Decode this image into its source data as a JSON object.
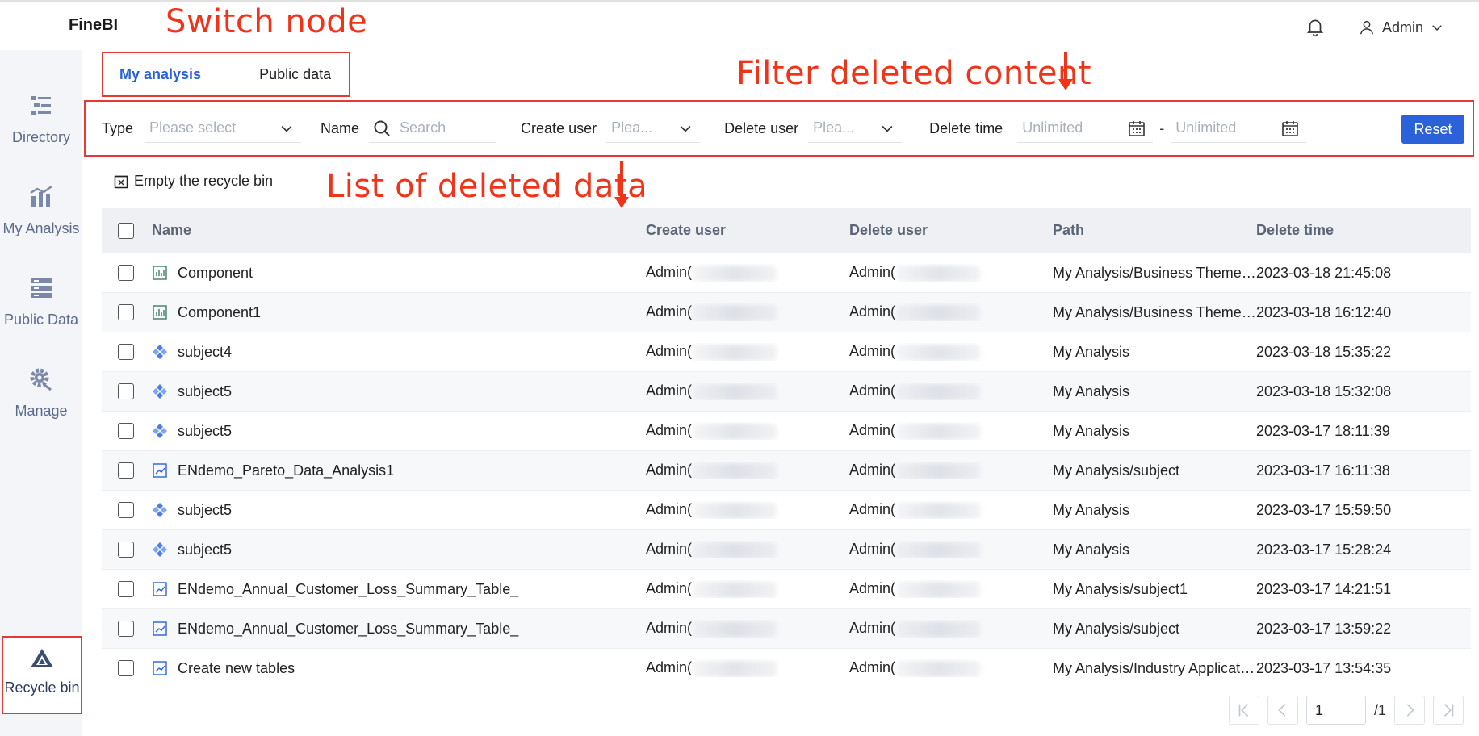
{
  "header": {
    "logo": "FineBI",
    "user": "Admin"
  },
  "sidebar": {
    "items": [
      {
        "label": "Directory",
        "icon": "directory-icon"
      },
      {
        "label": "My Analysis",
        "icon": "chart-icon"
      },
      {
        "label": "Public Data",
        "icon": "database-icon"
      },
      {
        "label": "Manage",
        "icon": "gear-icon"
      },
      {
        "label": "Recycle bin",
        "icon": "recycle-icon",
        "active": true
      }
    ]
  },
  "tabs": [
    "My analysis",
    "Public data"
  ],
  "active_tab": "My analysis",
  "annotations": {
    "switch_node": "Switch node",
    "filter": "Filter deleted content",
    "list": "List of deleted data"
  },
  "filters": {
    "type_label": "Type",
    "type_placeholder": "Please select",
    "name_label": "Name",
    "name_placeholder": "Search",
    "create_user_label": "Create user",
    "create_user_placeholder": "Plea...",
    "delete_user_label": "Delete user",
    "delete_user_placeholder": "Plea...",
    "delete_time_label": "Delete time",
    "start_placeholder": "Unlimited",
    "separator": "-",
    "end_placeholder": "Unlimited",
    "reset": "Reset"
  },
  "empty_bin": "Empty the recycle bin",
  "table": {
    "columns": [
      "Name",
      "Create user",
      "Delete user",
      "Path",
      "Delete time"
    ],
    "rows": [
      {
        "icon": "component",
        "name": "Component",
        "create_user": "Admin(",
        "delete_user": "Admin(",
        "path": "My Analysis/Business Theme…",
        "time": "2023-03-18 21:45:08"
      },
      {
        "icon": "component",
        "name": "Component1",
        "create_user": "Admin(",
        "delete_user": "Admin(",
        "path": "My Analysis/Business Theme…",
        "time": "2023-03-18 16:12:40"
      },
      {
        "icon": "subject",
        "name": "subject4",
        "create_user": "Admin(",
        "delete_user": "Admin(",
        "path": "My Analysis",
        "time": "2023-03-18 15:35:22"
      },
      {
        "icon": "subject",
        "name": "subject5",
        "create_user": "Admin(",
        "delete_user": "Admin(",
        "path": "My Analysis",
        "time": "2023-03-18 15:32:08"
      },
      {
        "icon": "subject",
        "name": "subject5",
        "create_user": "Admin(",
        "delete_user": "Admin(",
        "path": "My Analysis",
        "time": "2023-03-17 18:11:39"
      },
      {
        "icon": "dashboard",
        "name": "ENdemo_Pareto_Data_Analysis1",
        "create_user": "Admin(",
        "delete_user": "Admin(",
        "path": "My Analysis/subject",
        "time": "2023-03-17 16:11:38"
      },
      {
        "icon": "subject",
        "name": "subject5",
        "create_user": "Admin(",
        "delete_user": "Admin(",
        "path": "My Analysis",
        "time": "2023-03-17 15:59:50"
      },
      {
        "icon": "subject",
        "name": "subject5",
        "create_user": "Admin(",
        "delete_user": "Admin(",
        "path": "My Analysis",
        "time": "2023-03-17 15:28:24"
      },
      {
        "icon": "dashboard",
        "name": "ENdemo_Annual_Customer_Loss_Summary_Table_",
        "create_user": "Admin(",
        "delete_user": "Admin(",
        "path": "My Analysis/subject1",
        "time": "2023-03-17 14:21:51"
      },
      {
        "icon": "dashboard",
        "name": "ENdemo_Annual_Customer_Loss_Summary_Table_",
        "create_user": "Admin(",
        "delete_user": "Admin(",
        "path": "My Analysis/subject",
        "time": "2023-03-17 13:59:22"
      },
      {
        "icon": "dashboard",
        "name": "Create new tables",
        "create_user": "Admin(",
        "delete_user": "Admin(",
        "path": "My Analysis/Industry Applicat…",
        "time": "2023-03-17 13:54:35"
      }
    ]
  },
  "pager": {
    "page": "1",
    "total": "/1"
  },
  "colors": {
    "accent": "#2b62d9",
    "annotation": "#f0341a",
    "highlight_box": "#e53935"
  }
}
